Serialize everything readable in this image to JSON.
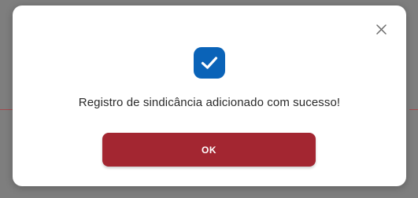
{
  "dialog": {
    "message": "Registro de sindicância adicionado com sucesso!",
    "ok_label": "OK",
    "close_icon": "close-icon",
    "status_icon": "check-icon"
  },
  "colors": {
    "accent": "#0a63b8",
    "primary_button": "#a32631",
    "backdrop": "#7e7e7e"
  }
}
